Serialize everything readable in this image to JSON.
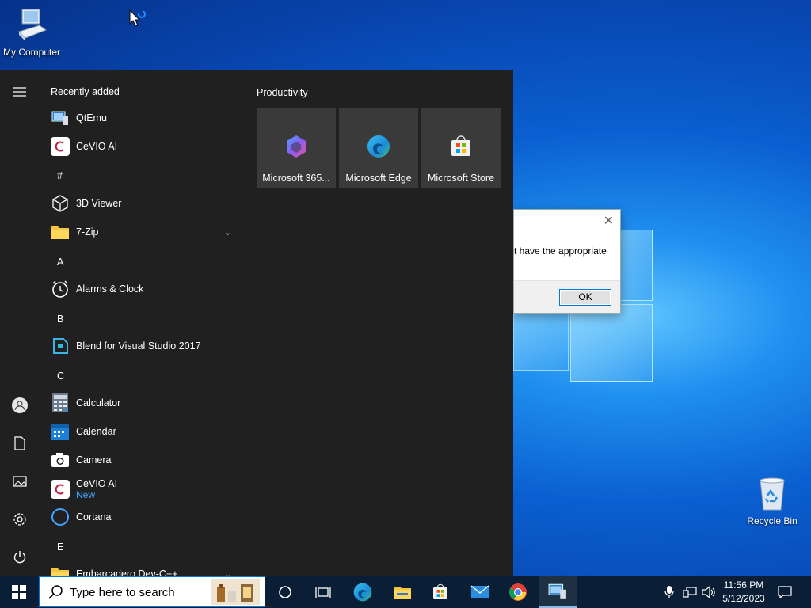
{
  "desktop": {
    "icons": [
      {
        "label": "My Computer",
        "icon": "computer-icon"
      },
      {
        "label": "Recycle Bin",
        "icon": "recycle-bin-icon"
      }
    ]
  },
  "dialog": {
    "message_fragment": "t have the appropriate",
    "ok_label": "OK",
    "close_glyph": "✕"
  },
  "start_menu": {
    "recently_added_header": "Recently added",
    "tiles_header": "Productivity",
    "apps": [
      {
        "label": "QtEmu",
        "icon": "qtemu-icon"
      },
      {
        "label": "CeVIO AI",
        "icon": "cevio-icon"
      },
      {
        "letter": "#"
      },
      {
        "label": "3D Viewer",
        "icon": "cube-icon"
      },
      {
        "label": "7-Zip",
        "icon": "folder-icon",
        "expandable": true
      },
      {
        "letter": "A"
      },
      {
        "label": "Alarms & Clock",
        "icon": "alarm-clock-icon"
      },
      {
        "letter": "B"
      },
      {
        "label": "Blend for Visual Studio 2017",
        "icon": "blend-icon"
      },
      {
        "letter": "C"
      },
      {
        "label": "Calculator",
        "icon": "calculator-icon"
      },
      {
        "label": "Calendar",
        "icon": "calendar-icon"
      },
      {
        "label": "Camera",
        "icon": "camera-icon"
      },
      {
        "label": "CeVIO AI",
        "icon": "cevio-icon",
        "sub": "New"
      },
      {
        "label": "Cortana",
        "icon": "cortana-icon"
      },
      {
        "letter": "E"
      },
      {
        "label": "Embarcadero Dev-C++",
        "icon": "folder-icon",
        "expandable": true
      }
    ],
    "tiles": [
      {
        "label": "Microsoft 365...",
        "icon": "m365-icon"
      },
      {
        "label": "Microsoft Edge",
        "icon": "edge-icon"
      },
      {
        "label": "Microsoft Store",
        "icon": "store-icon"
      }
    ],
    "rail": [
      "hamburger-icon",
      "user-icon",
      "documents-icon",
      "pictures-icon",
      "settings-icon",
      "power-icon"
    ]
  },
  "taskbar": {
    "search_placeholder": "Type here to search",
    "pinned": [
      "cortana-icon",
      "task-view-icon",
      "edge-icon",
      "file-explorer-icon",
      "store-icon",
      "mail-icon",
      "chrome-icon",
      "qtemu-icon"
    ],
    "clock_time": "11:56 PM",
    "clock_date": "5/12/2023"
  },
  "colors": {
    "start_bg": "#202020",
    "tile_bg": "#3a3a3a",
    "accent": "#0078d7",
    "taskbar_bg": "#0a1f35",
    "new_badge": "#3ea6ff"
  }
}
